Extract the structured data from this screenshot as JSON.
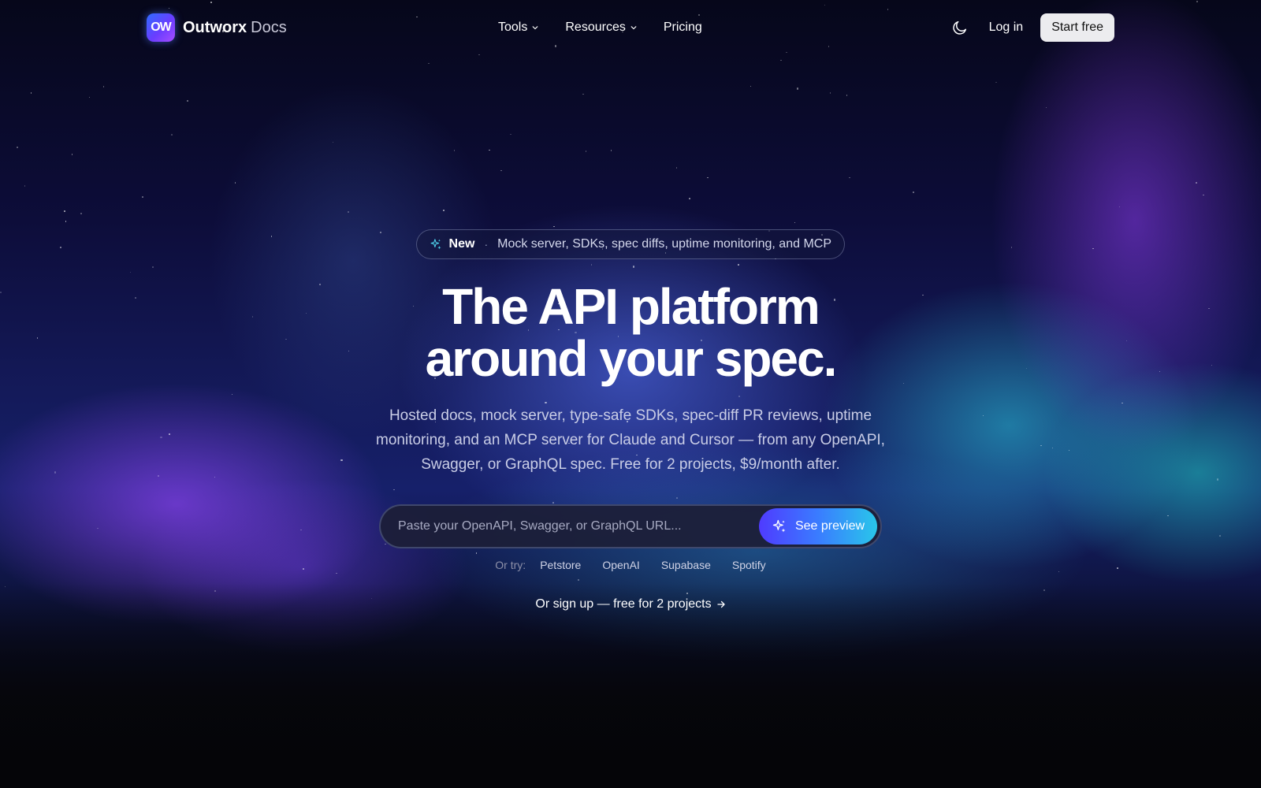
{
  "brand": {
    "logo_text": "OW",
    "name": "Outworx",
    "sub": "Docs"
  },
  "nav": {
    "links": [
      {
        "label": "Tools",
        "dropdown": true
      },
      {
        "label": "Resources",
        "dropdown": true
      },
      {
        "label": "Pricing",
        "dropdown": false
      }
    ],
    "theme_icon": "moon-icon",
    "login": "Log in",
    "start": "Start free"
  },
  "hero": {
    "badge": {
      "icon": "sparkle-icon",
      "new": "New",
      "separator": "·",
      "text": "Mock server, SDKs, spec diffs, uptime monitoring, and MCP"
    },
    "headline_line1": "The API platform",
    "headline_line2": "around your spec.",
    "subtext": "Hosted docs, mock server, type-safe SDKs, spec-diff PR reviews, uptime monitoring, and an MCP server for Claude and Cursor — from any OpenAPI, Swagger, or GraphQL spec. Free for 2 projects, $9/month after.",
    "input_placeholder": "Paste your OpenAPI, Swagger, or GraphQL URL...",
    "preview_button": "See preview",
    "try_label": "Or try:",
    "try_links": [
      "Petstore",
      "OpenAI",
      "Supabase",
      "Spotify"
    ],
    "signup": "Or sign up — free for 2 projects"
  },
  "colors": {
    "accent_gradient_start": "#4f3bff",
    "accent_gradient_end": "#29c6ea",
    "background": "#07081a"
  }
}
